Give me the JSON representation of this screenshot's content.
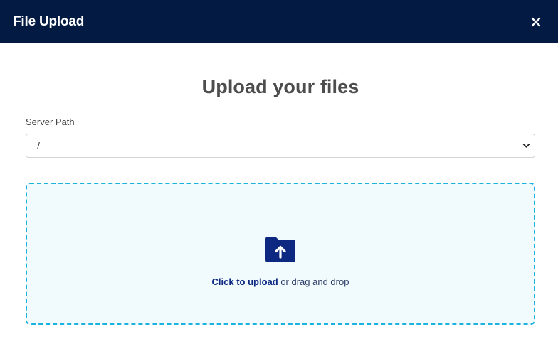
{
  "header": {
    "title": "File Upload",
    "close_icon": "close-icon"
  },
  "main": {
    "heading": "Upload your files",
    "server_path": {
      "label": "Server Path",
      "selected_value": "/"
    },
    "dropzone": {
      "icon": "folder-upload-icon",
      "link_text": "Click to upload",
      "rest_text": " or drag and drop"
    }
  },
  "colors": {
    "header_bg": "#031b42",
    "accent": "#0c2880",
    "dropzone_border": "#1bb2dd",
    "dropzone_bg": "#f1fafc"
  }
}
